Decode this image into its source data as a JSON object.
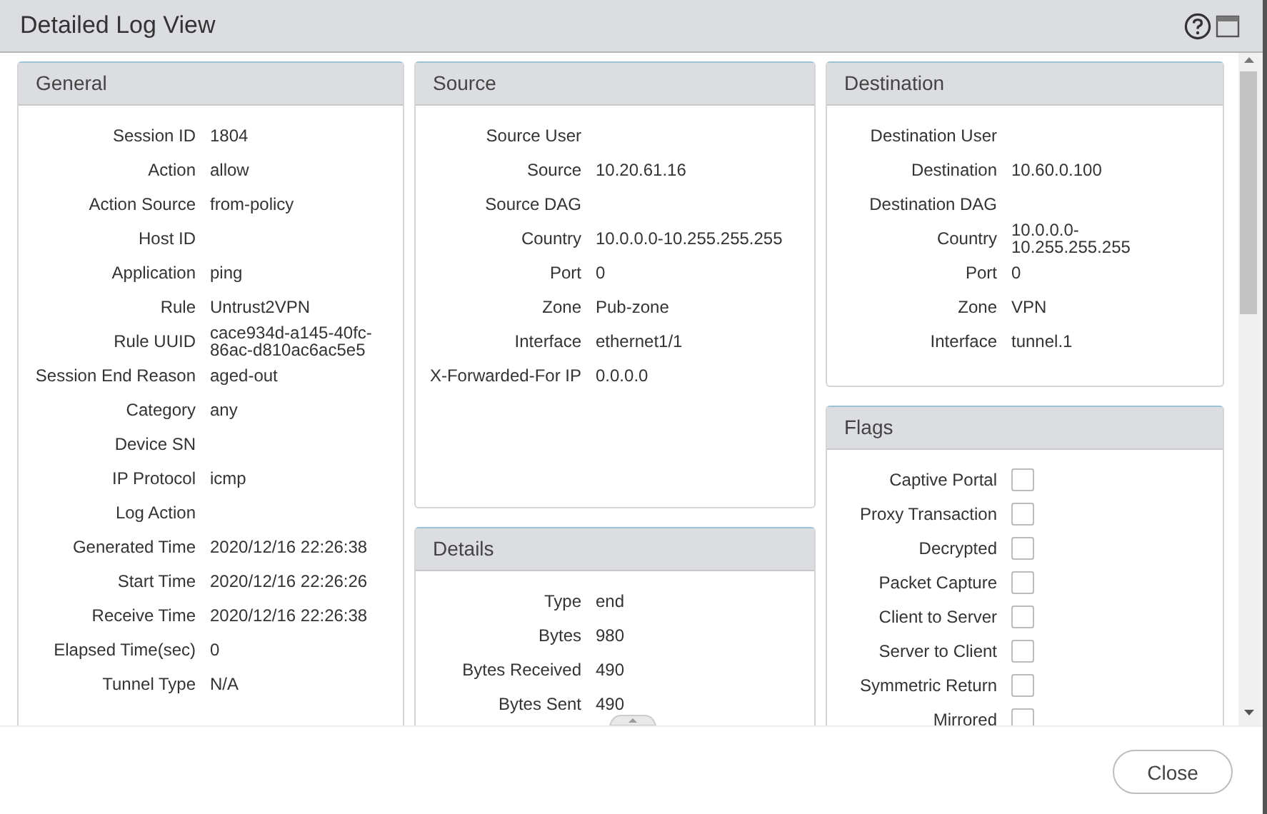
{
  "window": {
    "title": "Detailed Log View"
  },
  "columns": [
    [
      {
        "title": "General",
        "rows": [
          {
            "kind": "field",
            "label": "Session ID",
            "value": "1804"
          },
          {
            "kind": "field",
            "label": "Action",
            "value": "allow"
          },
          {
            "kind": "field",
            "label": "Action Source",
            "value": "from-policy"
          },
          {
            "kind": "field",
            "label": "Host ID"
          },
          {
            "kind": "field",
            "label": "Application",
            "value": "ping"
          },
          {
            "kind": "field",
            "label": "Rule",
            "value": "Untrust2VPN"
          },
          {
            "kind": "field",
            "label": "Rule UUID",
            "value": "cace934d-a145-40fc-86ac-d810ac6ac5e5"
          },
          {
            "kind": "field",
            "label": "Session End Reason",
            "value": "aged-out"
          },
          {
            "kind": "field",
            "label": "Category",
            "value": "any"
          },
          {
            "kind": "field",
            "label": "Device SN"
          },
          {
            "kind": "field",
            "label": "IP Protocol",
            "value": "icmp"
          },
          {
            "kind": "field",
            "label": "Log Action"
          },
          {
            "kind": "field",
            "label": "Generated Time",
            "value": "2020/12/16 22:26:38"
          },
          {
            "kind": "field",
            "label": "Start Time",
            "value": "2020/12/16 22:26:26"
          },
          {
            "kind": "field",
            "label": "Receive Time",
            "value": "2020/12/16 22:26:38"
          },
          {
            "kind": "field",
            "label": "Elapsed Time(sec)",
            "value": "0"
          },
          {
            "kind": "field",
            "label": "Tunnel Type",
            "value": "N/A"
          }
        ]
      }
    ],
    [
      {
        "title": "Source",
        "rows": [
          {
            "kind": "field",
            "label": "Source User"
          },
          {
            "kind": "field",
            "label": "Source",
            "value": "10.20.61.16"
          },
          {
            "kind": "field",
            "label": "Source DAG"
          },
          {
            "kind": "field",
            "label": "Country",
            "value": "10.0.0.0-10.255.255.255"
          },
          {
            "kind": "field",
            "label": "Port",
            "value": "0"
          },
          {
            "kind": "field",
            "label": "Zone",
            "value": "Pub-zone"
          },
          {
            "kind": "field",
            "label": "Interface",
            "value": "ethernet1/1"
          },
          {
            "kind": "field",
            "label": "X-Forwarded-For IP",
            "value": "0.0.0.0"
          }
        ]
      },
      {
        "title": "Details",
        "rows": [
          {
            "kind": "field",
            "label": "Type",
            "value": "end"
          },
          {
            "kind": "field",
            "label": "Bytes",
            "value": "980"
          },
          {
            "kind": "field",
            "label": "Bytes Received",
            "value": "490"
          },
          {
            "kind": "field",
            "label": "Bytes Sent",
            "value": "490"
          }
        ]
      }
    ],
    [
      {
        "title": "Destination",
        "rows": [
          {
            "kind": "field",
            "label": "Destination User"
          },
          {
            "kind": "field",
            "label": "Destination",
            "value": "10.60.0.100"
          },
          {
            "kind": "field",
            "label": "Destination DAG"
          },
          {
            "kind": "field",
            "label": "Country",
            "value": "10.0.0.0-10.255.255.255"
          },
          {
            "kind": "field",
            "label": "Port",
            "value": "0"
          },
          {
            "kind": "field",
            "label": "Zone",
            "value": "VPN"
          },
          {
            "kind": "field",
            "label": "Interface",
            "value": "tunnel.1"
          }
        ]
      },
      {
        "title": "Flags",
        "rows": [
          {
            "kind": "flag",
            "label": "Captive Portal",
            "checked": false
          },
          {
            "kind": "flag",
            "label": "Proxy Transaction",
            "checked": false
          },
          {
            "kind": "flag",
            "label": "Decrypted",
            "checked": false
          },
          {
            "kind": "flag",
            "label": "Packet Capture",
            "checked": false
          },
          {
            "kind": "flag",
            "label": "Client to Server",
            "checked": false
          },
          {
            "kind": "flag",
            "label": "Server to Client",
            "checked": false
          },
          {
            "kind": "flag",
            "label": "Symmetric Return",
            "checked": false
          },
          {
            "kind": "flag",
            "label": "Mirrored",
            "checked": false
          }
        ]
      }
    ]
  ],
  "buttons": [
    "Close"
  ]
}
